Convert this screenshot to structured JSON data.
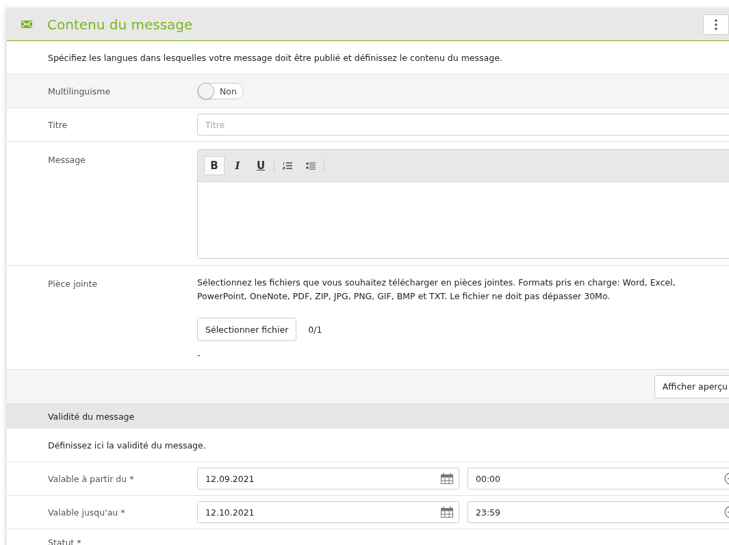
{
  "panel": {
    "title": "Contenu du message",
    "description": "Spécifiez les langues dans lesquelles votre message doit être publié et définissez le contenu du message."
  },
  "multilingual": {
    "label": "Multilinguisme",
    "on": false,
    "state_text": "Non"
  },
  "title_field": {
    "label": "Titre",
    "placeholder": "Titre"
  },
  "message": {
    "label": "Message",
    "toolbar": [
      {
        "kind": "bold",
        "label": "B",
        "selected": true
      },
      {
        "kind": "italic",
        "label": "I",
        "selected": false
      },
      {
        "kind": "underline",
        "label": "U",
        "selected": false
      },
      {
        "kind": "ordered-list",
        "selected": false
      },
      {
        "kind": "bullet-list",
        "selected": false
      }
    ]
  },
  "attachment": {
    "label": "Pièce jointe",
    "help": "Sélectionnez les fichiers que vous souhaitez télécharger en pièces jointes. Formats pris en charge: Word, Excel, PowerPoint, OneNote, PDF, ZIP, JPG, PNG, GIF, BMP et TXT. Le fichier ne doit pas dépasser 30Mo.",
    "button": "Sélectionner fichier",
    "count": "0/1",
    "file_name": "-"
  },
  "preview_button": "Afficher aperçu",
  "validity": {
    "title": "Validité du message",
    "description": "Définissez ici la validité du message.",
    "rows": [
      {
        "label": "Valable à partir du *",
        "date": "12.09.2021",
        "time": "00:00"
      },
      {
        "label": "Valable jusqu'au *",
        "date": "12.10.2021",
        "time": "23:59"
      }
    ],
    "status_label": "Statut *"
  }
}
